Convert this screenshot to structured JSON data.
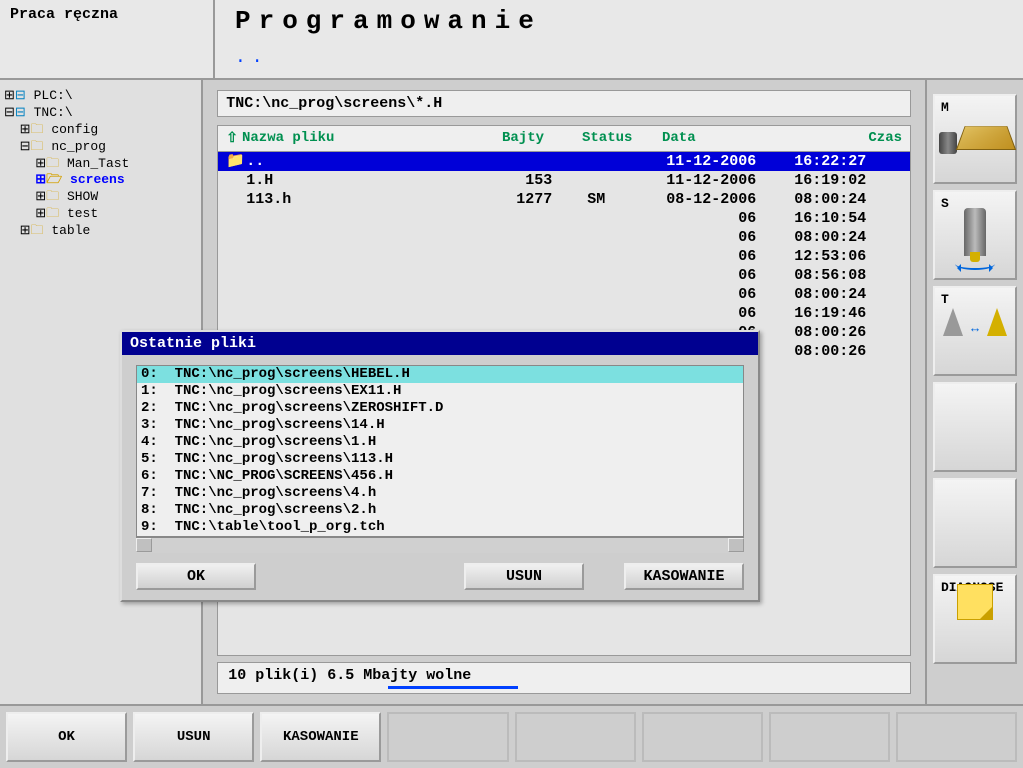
{
  "header": {
    "mode": "Praca ręczna",
    "title": "Programowanie",
    "subtitle": ".."
  },
  "tree": {
    "plc": "PLC:\\",
    "tnc": "TNC:\\",
    "config": "config",
    "nc_prog": "nc_prog",
    "man_tast": "Man_Tast",
    "screens": "screens",
    "show": "SHOW",
    "test": "test",
    "table": "table"
  },
  "path": "TNC:\\nc_prog\\screens\\*.H",
  "columns": {
    "name": "Nazwa pliku",
    "bytes": "Bajty",
    "status": "Status",
    "date": "Data",
    "time": "Czas"
  },
  "files": [
    {
      "name": "..",
      "bytes": "",
      "status": "",
      "date": "11-12-2006",
      "time": "16:22:27",
      "hl": true,
      "icon": "📁"
    },
    {
      "name": "1.H",
      "bytes": "153",
      "status": "",
      "date": "11-12-2006",
      "time": "16:19:02"
    },
    {
      "name": "113.h",
      "bytes": "1277",
      "status": "SM",
      "date": "08-12-2006",
      "time": "08:00:24"
    },
    {
      "name": "",
      "bytes": "",
      "status": "",
      "date": "06",
      "time": "16:10:54",
      "partial": true
    },
    {
      "name": "",
      "bytes": "",
      "status": "",
      "date": "06",
      "time": "08:00:24",
      "partial": true
    },
    {
      "name": "",
      "bytes": "",
      "status": "",
      "date": "06",
      "time": "12:53:06",
      "partial": true
    },
    {
      "name": "",
      "bytes": "",
      "status": "",
      "date": "06",
      "time": "08:56:08",
      "partial": true
    },
    {
      "name": "",
      "bytes": "",
      "status": "",
      "date": "06",
      "time": "08:00:24",
      "partial": true
    },
    {
      "name": "",
      "bytes": "",
      "status": "",
      "date": "06",
      "time": "16:19:46",
      "partial": true
    },
    {
      "name": "",
      "bytes": "",
      "status": "",
      "date": "06",
      "time": "08:00:26",
      "partial": true
    },
    {
      "name": "",
      "bytes": "",
      "status": "",
      "date": "06",
      "time": "08:00:26",
      "partial": true
    }
  ],
  "status": "10  plik(i)    6.5 Mbajty wolne",
  "dialog": {
    "title": "Ostatnie pliki",
    "items": [
      "0:  TNC:\\nc_prog\\screens\\HEBEL.H",
      "1:  TNC:\\nc_prog\\screens\\EX11.H",
      "2:  TNC:\\nc_prog\\screens\\ZEROSHIFT.D",
      "3:  TNC:\\nc_prog\\screens\\14.H",
      "4:  TNC:\\nc_prog\\screens\\1.H",
      "5:  TNC:\\nc_prog\\screens\\113.H",
      "6:  TNC:\\NC_PROG\\SCREENS\\456.H",
      "7:  TNC:\\nc_prog\\screens\\4.h",
      "8:  TNC:\\nc_prog\\screens\\2.h",
      "9:  TNC:\\table\\tool_p_org.tch"
    ],
    "ok": "OK",
    "usun": "USUN",
    "kasowanie": "KASOWANIE"
  },
  "vkeys": {
    "m": "M",
    "s": "S",
    "t": "T",
    "diagnose": "DIAGNOSE"
  },
  "hkeys": {
    "ok": "OK",
    "usun": "USUN",
    "kasowanie": "KASOWANIE"
  }
}
